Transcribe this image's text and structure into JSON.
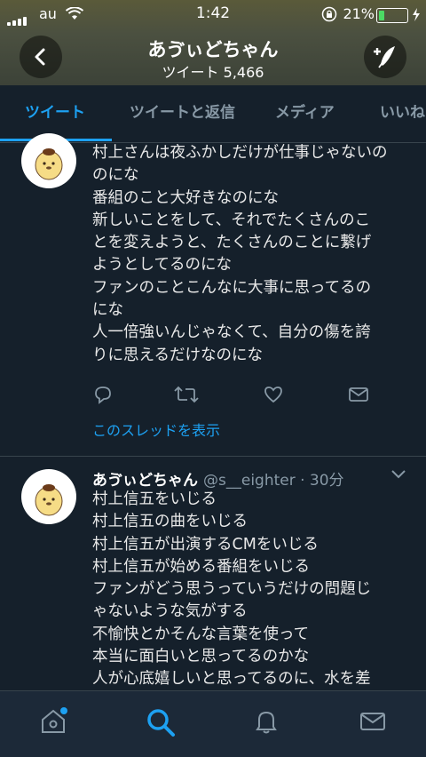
{
  "status_bar": {
    "carrier": "au",
    "time": "1:42",
    "battery": "21%",
    "battery_level": 0.21
  },
  "header": {
    "title": "あゔぃどちゃん",
    "tweet_count": "ツイート 5,466"
  },
  "tabs": [
    {
      "label": "ツイート",
      "active": true
    },
    {
      "label": "ツイートと返信",
      "active": false
    },
    {
      "label": "メディア",
      "active": false
    },
    {
      "label": "いいね",
      "active": false
    }
  ],
  "tweet1": {
    "lines": [
      "村上さんは夜ふかしだけが仕事じゃないの",
      "のにな",
      "番組のこと大好きなのにな",
      "新しいことをして、それでたくさんのこ",
      "とを変えようと、たくさんのことに繋げ",
      "ようとしてるのにな",
      "ファンのことこんなに大事に思ってるの",
      "にな",
      "人一倍強いんじゃなくて、自分の傷を誇",
      "りに思えるだけなのにな"
    ],
    "thread_link": "このスレッドを表示"
  },
  "tweet2": {
    "name": "あゔぃどちゃん",
    "handle": "@s__eighter · 30分",
    "lines": [
      "村上信五をいじる",
      "村上信五の曲をいじる",
      "村上信五が出演するCMをいじる",
      "村上信五が始める番組をいじる",
      "ファンがどう思うっていうだけの問題じ",
      "ゃないような気がする",
      "不愉快とかそんな言葉を使って",
      "本当に面白いと思ってるのかな",
      "人が心底嬉しいと思ってるのに、水を差"
    ]
  },
  "colors": {
    "accent": "#1da1f2",
    "background": "#15202b",
    "muted": "#8899a6"
  },
  "icons": [
    "back-arrow-icon",
    "compose-icon",
    "reply-icon",
    "retweet-icon",
    "like-icon",
    "dm-icon",
    "home-icon",
    "search-icon",
    "notifications-icon",
    "messages-icon",
    "chevron-down-icon"
  ]
}
